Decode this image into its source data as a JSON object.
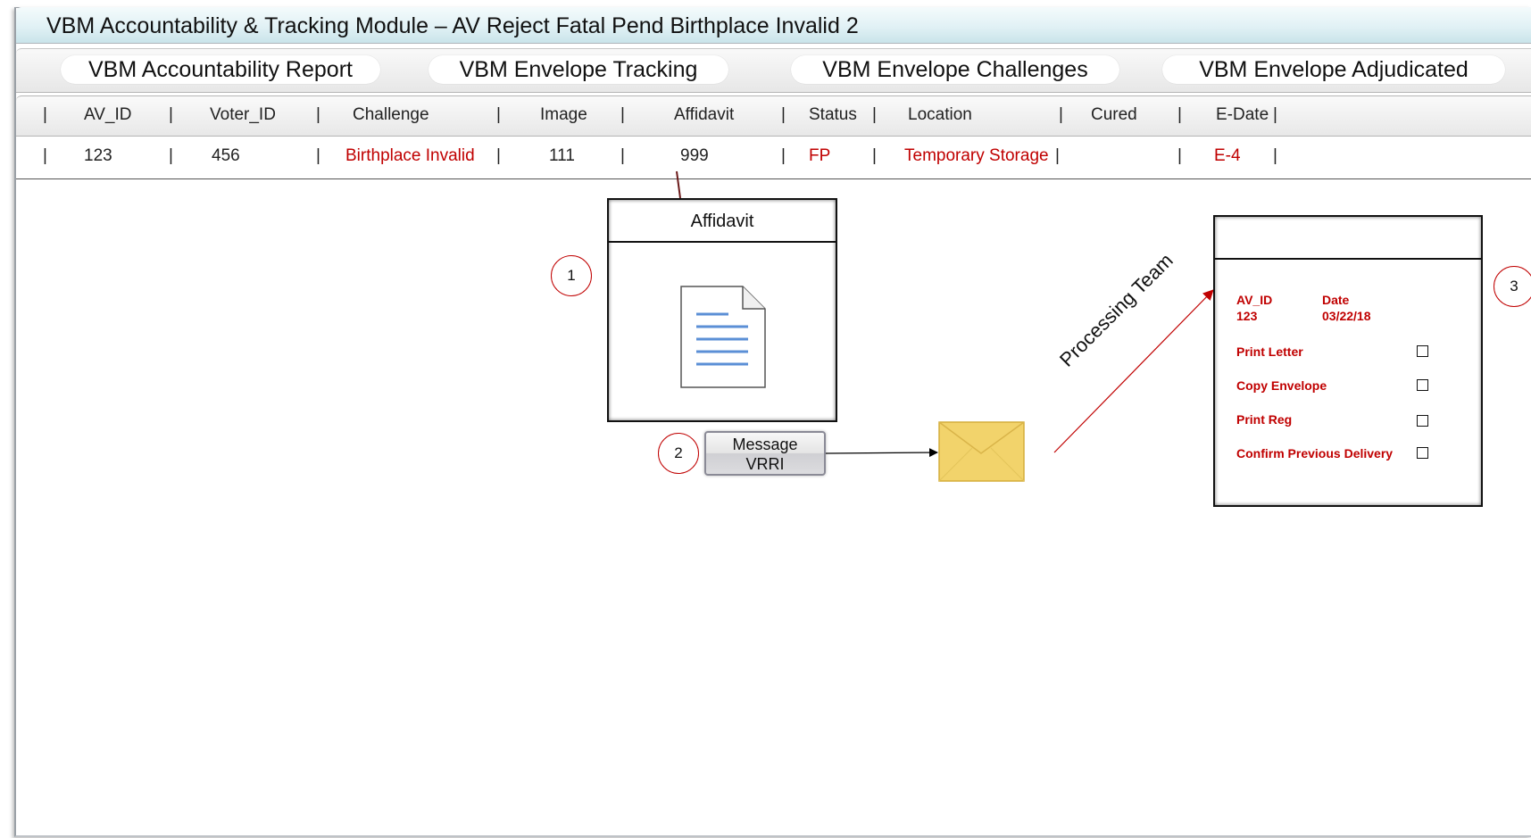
{
  "window": {
    "title": "VBM Accountability & Tracking Module – AV Reject Fatal Pend Birthplace Invalid 2"
  },
  "tabs": [
    {
      "label": "VBM Accountability Report"
    },
    {
      "label": "VBM Envelope Tracking"
    },
    {
      "label": "VBM Envelope Challenges"
    },
    {
      "label": "VBM Envelope Adjudicated"
    }
  ],
  "table": {
    "columns": [
      "AV_ID",
      "Voter_ID",
      "Challenge",
      "Image",
      "Affidavit",
      "Status",
      "Location",
      "Cured",
      "E-Date"
    ],
    "row": {
      "av_id": "123",
      "voter_id": "456",
      "challenge": "Birthplace Invalid",
      "image": "111",
      "affidavit": "999",
      "status": "FP",
      "location": "Temporary Storage",
      "cured": "",
      "e_date": "E-4"
    }
  },
  "diagram": {
    "step1": "1",
    "step2": "2",
    "step3": "3",
    "affidavit_title": "Affidavit",
    "message_button": {
      "line1": "Message",
      "line2": "VRRI"
    },
    "arrow_label": "Processing Team",
    "panel": {
      "av_id_label": "AV_ID",
      "av_id_value": "123",
      "date_label": "Date",
      "date_value": "03/22/18",
      "tasks": [
        "Print Letter",
        "Copy Envelope",
        "Print Reg",
        "Confirm Previous Delivery"
      ]
    }
  },
  "colors": {
    "accent_red": "#c00000",
    "envelope": "#f2d36b",
    "doc_lines": "#5b8fd6"
  }
}
